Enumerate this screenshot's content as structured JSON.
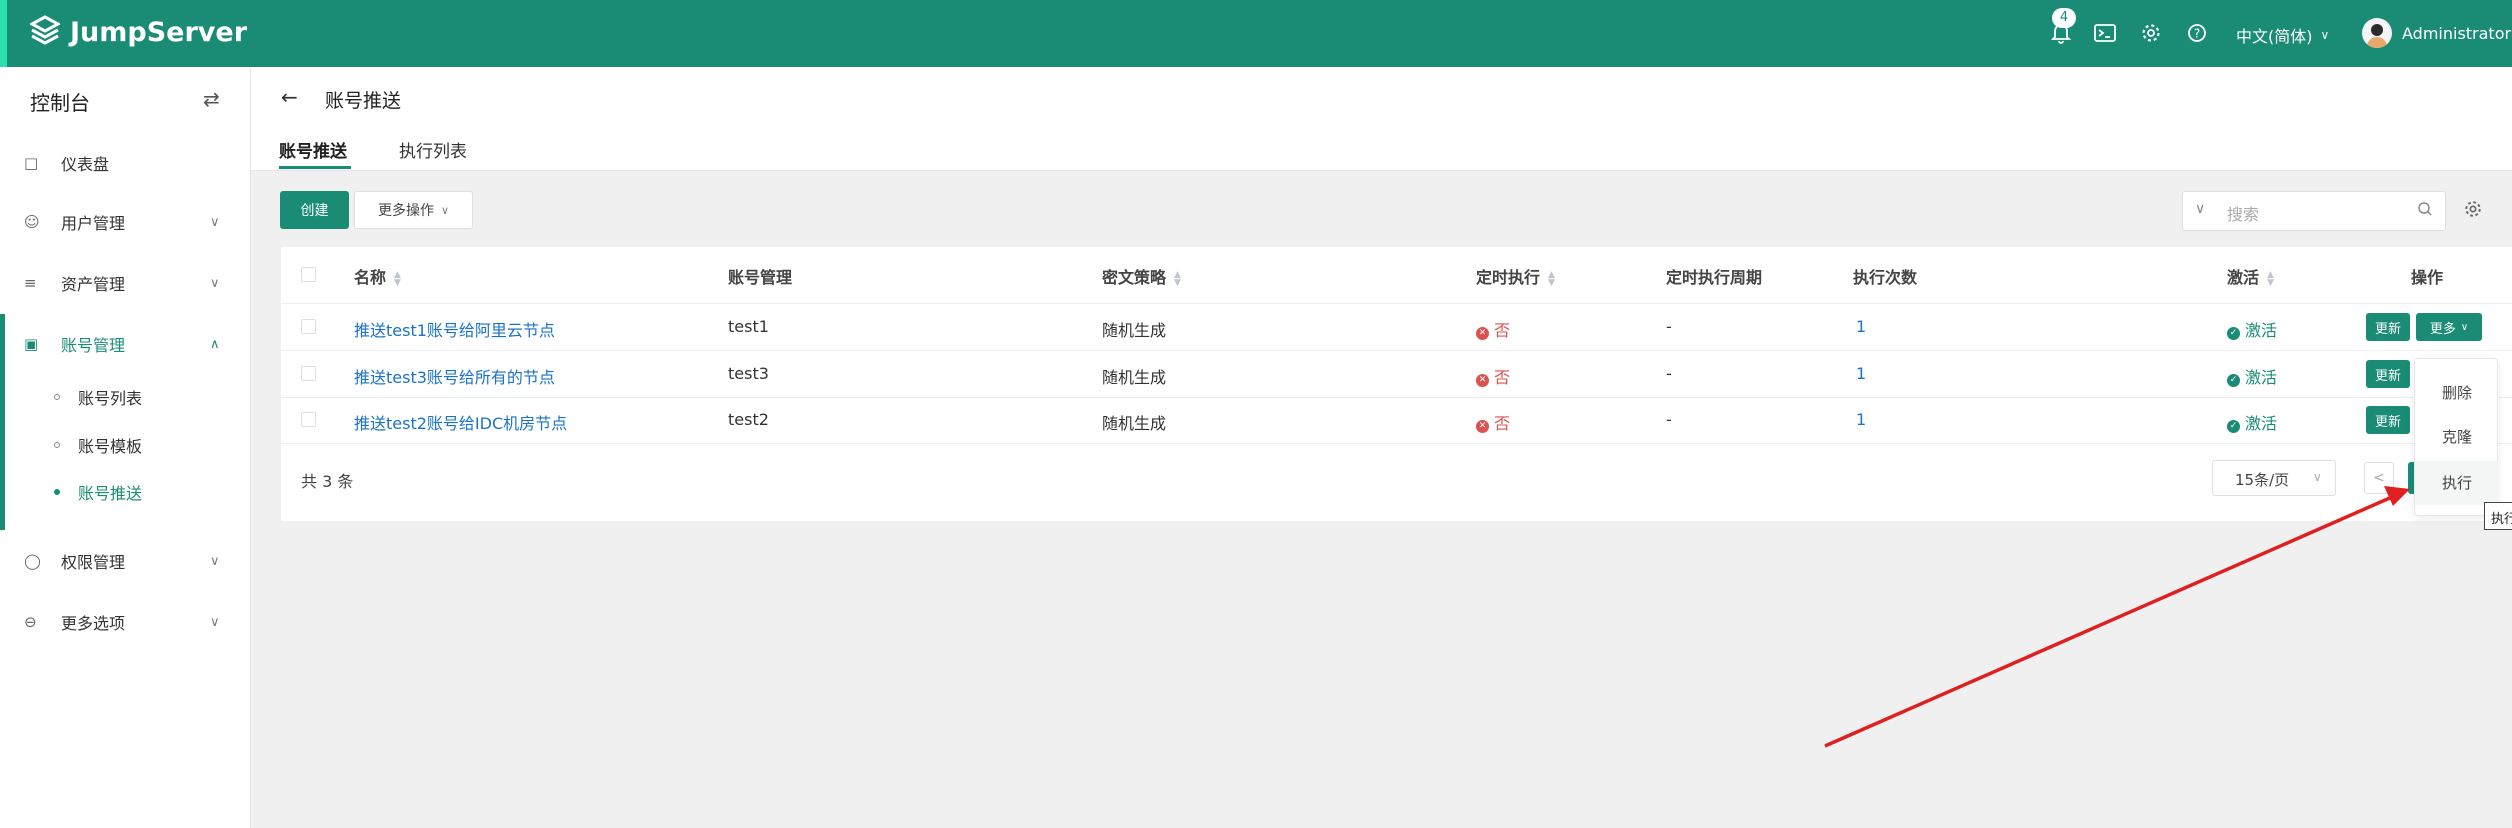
{
  "header": {
    "brand": "JumpServer",
    "notification_count": "4",
    "language": "中文(简体)",
    "user": "Administrator",
    "icons": [
      "bell-icon",
      "terminal-icon",
      "gear-icon",
      "help-icon"
    ],
    "brand_color": "#1a8c76"
  },
  "sidebar": {
    "title": "控制台",
    "items": [
      {
        "label": "仪表盘",
        "icon": "dashboard-icon"
      },
      {
        "label": "用户管理",
        "icon": "users-icon"
      },
      {
        "label": "资产管理",
        "icon": "assets-icon"
      },
      {
        "label": "账号管理",
        "icon": "accounts-icon",
        "active": true
      },
      {
        "label": "权限管理",
        "icon": "shield-icon"
      },
      {
        "label": "更多选项",
        "icon": "more-icon"
      }
    ],
    "subitems": [
      {
        "label": "账号列表"
      },
      {
        "label": "账号模板"
      },
      {
        "label": "账号推送",
        "active": true
      }
    ]
  },
  "page": {
    "title": "账号推送",
    "tabs": [
      {
        "label": "账号推送",
        "active": true
      },
      {
        "label": "执行列表"
      }
    ]
  },
  "toolbar": {
    "create_label": "创建",
    "more_actions_label": "更多操作",
    "search_placeholder": "搜索"
  },
  "table": {
    "columns": [
      "名称",
      "账号管理",
      "密文策略",
      "定时执行",
      "定时执行周期",
      "执行次数",
      "激活",
      "操作"
    ],
    "rows": [
      {
        "name": "推送test1账号给阿里云节点",
        "account": "test1",
        "strategy": "随机生成",
        "scheduled": "否",
        "period": "-",
        "count": "1",
        "active": "激活"
      },
      {
        "name": "推送test3账号给所有的节点",
        "account": "test3",
        "strategy": "随机生成",
        "scheduled": "否",
        "period": "-",
        "count": "1",
        "active": "激活"
      },
      {
        "name": "推送test2账号给IDC机房节点",
        "account": "test2",
        "strategy": "随机生成",
        "scheduled": "否",
        "period": "-",
        "count": "1",
        "active": "激活"
      }
    ],
    "update_label": "更新",
    "more_label": "更多",
    "total": "共 3 条"
  },
  "pagination": {
    "page_size": "15条/页"
  },
  "dropdown": {
    "items": [
      "删除",
      "克隆",
      "执行"
    ]
  },
  "tooltip": "执行"
}
